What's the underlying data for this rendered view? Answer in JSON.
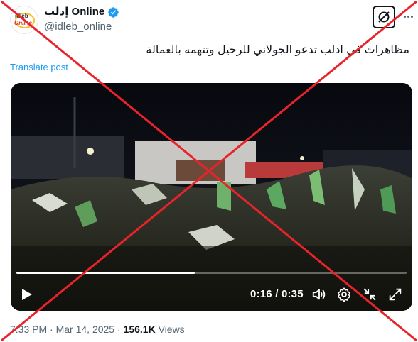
{
  "account": {
    "display_name": "إدلب Online",
    "handle": "@idleb_online",
    "avatar_logo_top": "idleb",
    "avatar_logo_bottom": "Online"
  },
  "post": {
    "text": "مظاهرات في ادلب تدعو الجولاني للرحيل وتتهمه بالعمالة",
    "translate_label": "Translate post"
  },
  "video": {
    "time_current": "0:16",
    "time_separator": " / ",
    "time_total": "0:35",
    "progress_fraction": 0.457
  },
  "meta": {
    "time": "7:33 PM",
    "separator": " · ",
    "date": "Mar 14, 2025",
    "views_count": "156.1K",
    "views_label": " Views"
  },
  "icons": {
    "verified": "verified-badge-icon",
    "grok": "grok-icon",
    "play": "play-icon",
    "volume": "volume-icon",
    "settings": "settings-gear-icon",
    "minimize": "minimize-icon",
    "fullscreen": "fullscreen-icon"
  },
  "colors": {
    "link": "#1d9bf0",
    "verified": "#1d9bf0",
    "cross": "#e8232a"
  }
}
